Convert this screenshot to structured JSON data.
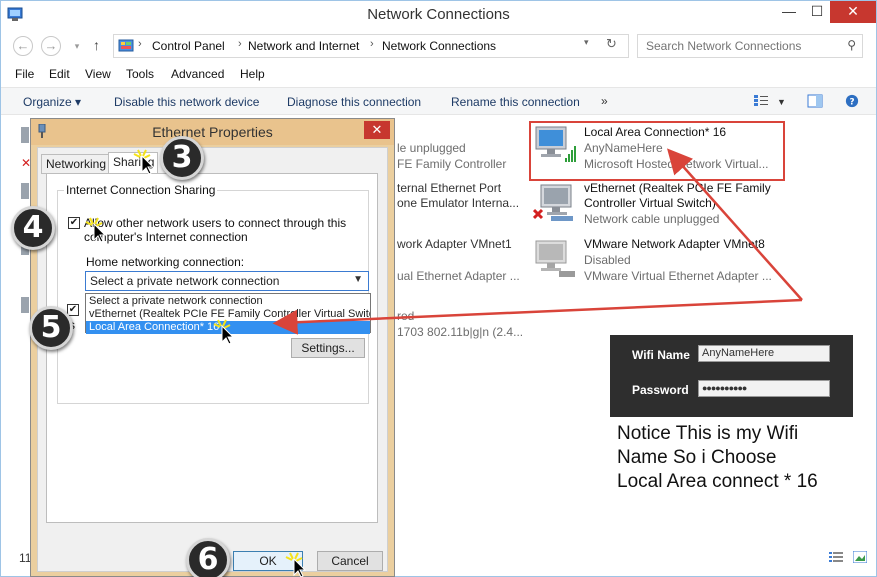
{
  "window": {
    "title": "Network Connections",
    "min_glyph": "—",
    "max_glyph": "☐",
    "close_glyph": "✕"
  },
  "address": {
    "back_glyph": "←",
    "forward_glyph": "→",
    "up_glyph": "↑",
    "crumbs": [
      "Control Panel",
      "Network and Internet",
      "Network Connections"
    ],
    "sep_glyph": "›",
    "search_placeholder": "Search Network Connections",
    "search_icon": "search-icon"
  },
  "menubar": [
    "File",
    "Edit",
    "View",
    "Tools",
    "Advanced",
    "Help"
  ],
  "commandbar": {
    "organize": "Organize ▾",
    "disable": "Disable this network device",
    "diagnose": "Diagnose this connection",
    "rename": "Rename this connection",
    "more": "»"
  },
  "connections": {
    "lac16": {
      "name": "Local Area Connection* 16",
      "network": "AnyNameHere",
      "adapter": "Microsoft Hosted Network Virtual..."
    },
    "vethernet": {
      "name": "vEthernet (Realtek PCIe FE Family",
      "name2": "Controller Virtual Switch)",
      "status": "Network cable unplugged"
    },
    "vmnet8": {
      "name": "VMware Network Adapter VMnet8",
      "status": "Disabled",
      "adapter": "VMware Virtual Ethernet Adapter ..."
    }
  },
  "partial_items": {
    "a1": "le unplugged",
    "a2": "FE Family Controller",
    "b1": "ternal Ethernet Port",
    "b2": "one Emulator Interna...",
    "c1": "work Adapter VMnet1",
    "c2": "ual Ethernet Adapter ...",
    "d1": "red",
    "d2": "1703 802.11b|g|n (2.4..."
  },
  "dialog": {
    "title": "Ethernet Properties",
    "close_glyph": "✕",
    "tabs": [
      "Networking",
      "Sharing"
    ],
    "group_label": "Internet Connection Sharing",
    "allow_line1": "Allow other network users to connect through this",
    "allow_line2": "computer's Internet connection",
    "home_label": "Home networking connection:",
    "select_value": "Select a private network connection",
    "caret_glyph": "▼",
    "options": [
      "Select a private network connection",
      "vEthernet (Realtek PCIe FE Family Controller Virtual Switch)",
      "Local Area Connection* 16"
    ],
    "second_check_frag": "s",
    "settings": "Settings...",
    "ok": "OK",
    "cancel": "Cancel",
    "check_glyph": "✔"
  },
  "badges": [
    "3",
    "4",
    "5",
    "6"
  ],
  "wifi": {
    "name_label": "Wifi Name",
    "name_value": "AnyNameHere",
    "password_label": "Password",
    "password_value": "●●●●●●●●●●"
  },
  "notice": {
    "line1": "Notice This is my Wifi",
    "line2": "Name So i Choose",
    "line3": "Local Area connect * 16"
  },
  "status": {
    "count_frag": "11"
  },
  "colors": {
    "annotation_red": "#d9443a",
    "dialog_frame": "#ebcf9f",
    "selection_blue": "#3390f0",
    "signal_green": "#2e9e3a"
  }
}
